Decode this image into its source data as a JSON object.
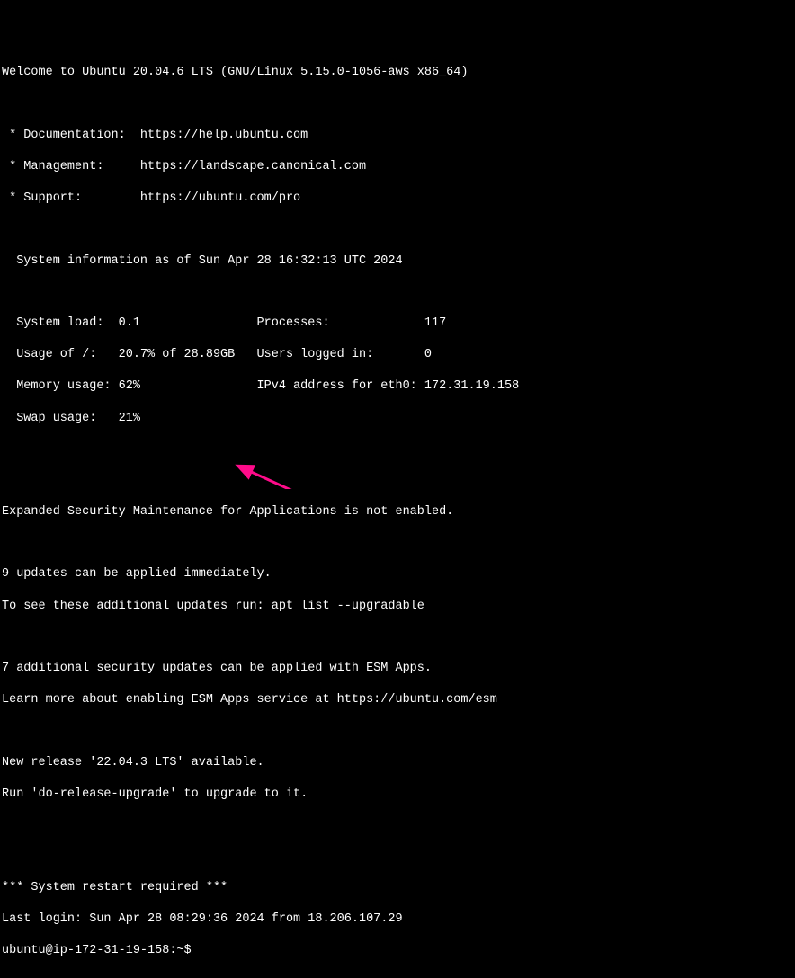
{
  "welcome": "Welcome to Ubuntu 20.04.6 LTS (GNU/Linux 5.15.0-1056-aws x86_64)",
  "links": {
    "doc": " * Documentation:  https://help.ubuntu.com",
    "mgmt": " * Management:     https://landscape.canonical.com",
    "sup": " * Support:        https://ubuntu.com/pro"
  },
  "sysinfo_header": "  System information as of Sun Apr 28 16:32:13 UTC 2024",
  "stats": {
    "l1": "  System load:  0.1                Processes:             117",
    "l2": "  Usage of /:   20.7% of 28.89GB   Users logged in:       0",
    "l3": "  Memory usage: 62%                IPv4 address for eth0: 172.31.19.158",
    "l4": "  Swap usage:   21%"
  },
  "esm_notice": "Expanded Security Maintenance for Applications is not enabled.",
  "updates": {
    "l1": "9 updates can be applied immediately.",
    "l2": "To see these additional updates run: apt list --upgradable"
  },
  "esm_extra": {
    "l1": "7 additional security updates can be applied with ESM Apps.",
    "l2": "Learn more about enabling ESM Apps service at https://ubuntu.com/esm"
  },
  "release": {
    "l1": "New release '22.04.3 LTS' available.",
    "l2": "Run 'do-release-upgrade' to upgrade to it."
  },
  "restart": "*** System restart required ***",
  "last_login": "Last login: Sun Apr 28 08:29:36 2024 from 18.206.107.29",
  "prompt": "ubuntu@ip-172-31-19-158:~$ ",
  "arrow_color": "#ff0b8a"
}
